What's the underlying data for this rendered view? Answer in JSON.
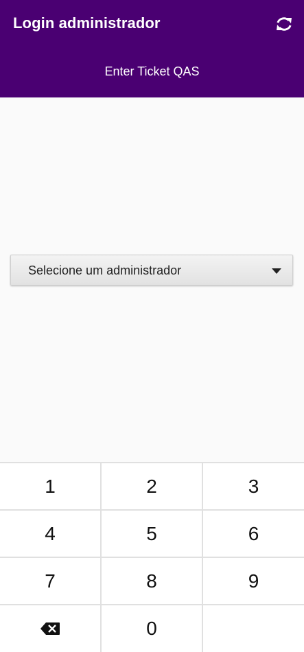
{
  "colors": {
    "app_bar": "#4a0072",
    "app_bar_text": "#ffffff",
    "background": "#fafafa",
    "keypad_divider": "#e0e0e0"
  },
  "header": {
    "title": "Login administrador",
    "refresh_icon": "refresh-icon",
    "subtitle": "Enter Ticket QAS"
  },
  "admin_select": {
    "selected": "Selecione um administrador",
    "arrow_icon": "dropdown-arrow-icon"
  },
  "keypad": {
    "keys": [
      "1",
      "2",
      "3",
      "4",
      "5",
      "6",
      "7",
      "8",
      "9"
    ],
    "backspace_icon": "backspace-icon",
    "zero": "0"
  }
}
